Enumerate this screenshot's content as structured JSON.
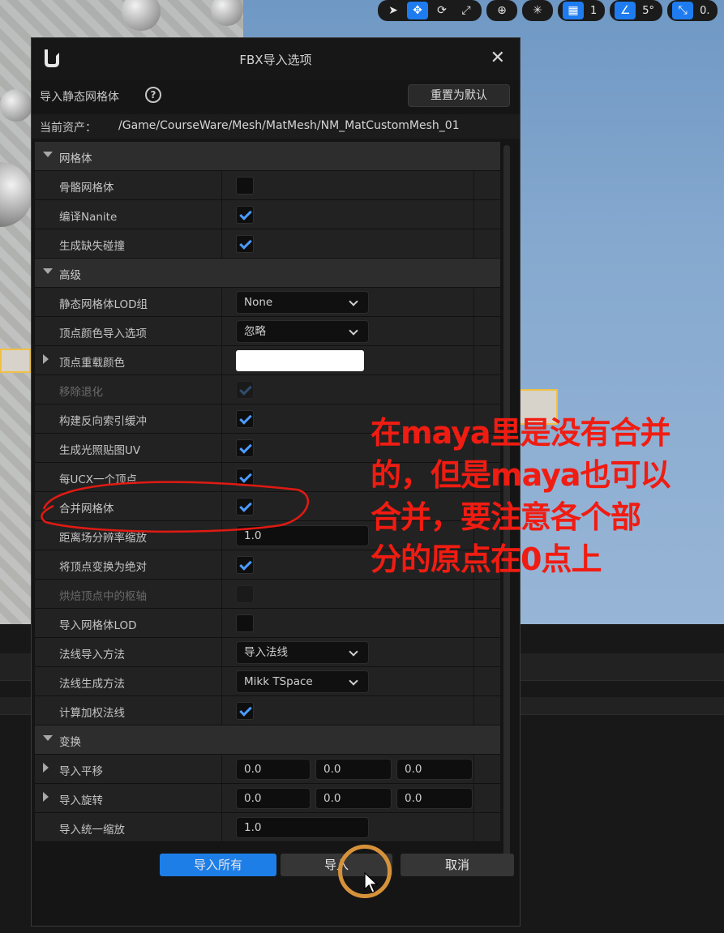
{
  "toolbar": {
    "values": [
      "1",
      "5°",
      "0."
    ]
  },
  "dialog": {
    "title": "FBX导入选项",
    "subhead_label": "导入静态网格体",
    "reset_label": "重置为默认",
    "current_asset_label": "当前资产：",
    "current_asset_path": "/Game/CourseWare/Mesh/MatMesh/NM_MatCustomMesh_01"
  },
  "sections": {
    "mesh": {
      "label": "网格体",
      "skeletal": "骨骼网格体",
      "nanite": "编译Nanite",
      "collision": "生成缺失碰撞"
    },
    "advanced": {
      "label": "高级",
      "lod_group": "静态网格体LOD组",
      "lod_group_value": "None",
      "vertex_color_import": "顶点颜色导入选项",
      "vertex_color_import_value": "忽略",
      "vertex_override_color": "顶点重载颜色",
      "remove_degenerates": "移除退化",
      "reverse_index": "构建反向索引缓冲",
      "lightmap_uv": "生成光照贴图UV",
      "one_convex_per_ucx": "每UCX一个顶点",
      "combine_meshes": "合并网格体",
      "distance_field_scale": "距离场分辨率缩放",
      "distance_field_scale_value": "1.0",
      "transform_absolute": "将顶点变换为绝对",
      "bake_pivot": "烘焙顶点中的枢轴",
      "import_lods": "导入网格体LOD",
      "normal_import_method": "法线导入方法",
      "normal_import_method_value": "导入法线",
      "normal_gen_method": "法线生成方法",
      "normal_gen_method_value": "Mikk TSpace",
      "weighted_normals": "计算加权法线"
    },
    "transform": {
      "label": "变换",
      "translation": "导入平移",
      "translation_values": [
        "0.0",
        "0.0",
        "0.0"
      ],
      "rotation": "导入旋转",
      "rotation_values": [
        "0.0",
        "0.0",
        "0.0"
      ],
      "uniform_scale": "导入统一缩放",
      "uniform_scale_value": "1.0"
    }
  },
  "footer": {
    "import_all": "导入所有",
    "import": "导入",
    "cancel": "取消"
  },
  "annotation": {
    "note_lines": [
      "在maya里是没有合并",
      "的，但是maya也可以",
      "合并，要注意各个部",
      "分的原点在0点上"
    ],
    "color": "#f01c12"
  },
  "colors": {
    "accent": "#1e7ee8",
    "check": "#4c9bff"
  }
}
